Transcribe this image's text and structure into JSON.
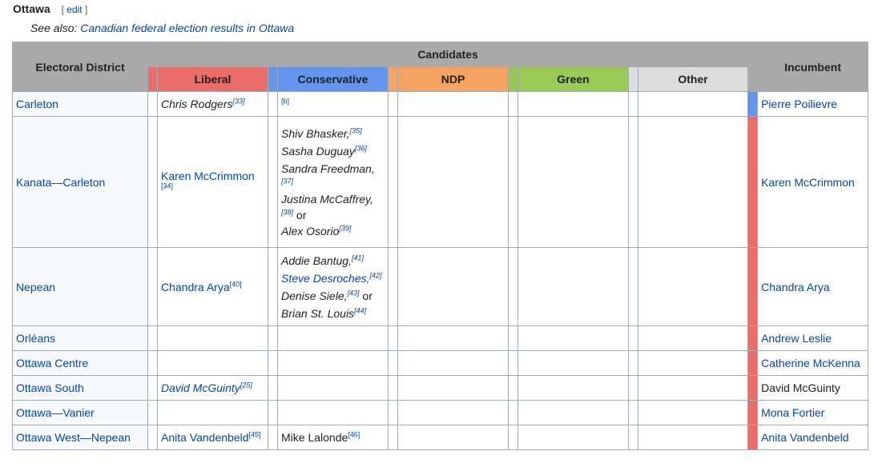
{
  "heading": {
    "title": "Ottawa",
    "edit_open": "[",
    "edit_label": "edit",
    "edit_close": "]"
  },
  "see_also": {
    "prefix": "See also:",
    "link": "Canadian federal election results in Ottawa"
  },
  "headers": {
    "district": "Electoral District",
    "candidates": "Candidates",
    "incumbent": "Incumbent",
    "liberal": "Liberal",
    "conservative": "Conservative",
    "ndp": "NDP",
    "green": "Green",
    "other": "Other"
  },
  "colors": {
    "liberal": "#EA6D6A",
    "conservative": "#6495ED",
    "ndp": "#F4A460",
    "green": "#99C955",
    "other": "#DCDCDC",
    "header_gray": "#a9a9a9"
  },
  "rows": [
    {
      "district": "Carleton",
      "liberal": "Chris Rodgers",
      "liberal_ref": "[33]",
      "conservative_ref": "[b]",
      "incumbent": "Pierre Poilievre"
    },
    {
      "district": "Kanata—Carleton",
      "liberal": "Karen McCrimmon",
      "liberal_ref": "[34]",
      "cons": [
        {
          "name": "Shiv Bhasker,",
          "ref": "[35]"
        },
        {
          "name": "Sasha Duguay",
          "ref": "[36]"
        },
        {
          "name": "Sandra Freedman,",
          "ref": ""
        },
        {
          "name": "",
          "ref": "[37]"
        },
        {
          "name": "Justina McCaffrey,",
          "ref": ""
        },
        {
          "name": "",
          "ref": "[38]",
          "tail": " or"
        },
        {
          "name": "Alex Osorio",
          "ref": "[39]"
        }
      ],
      "incumbent": "Karen McCrimmon"
    },
    {
      "district": "Nepean",
      "liberal": "Chandra Arya",
      "liberal_ref": "[40]",
      "cons": [
        {
          "name": "Addie Bantug,",
          "ref": "[41]"
        },
        {
          "name": "Steve Desroches,",
          "ref": "[42]"
        },
        {
          "name": "Denise Siele,",
          "ref": "[43]",
          "tail": " or"
        },
        {
          "name": "Brian St. Louis",
          "ref": "[44]"
        }
      ],
      "incumbent": "Chandra Arya"
    },
    {
      "district": "Orléans",
      "incumbent": "Andrew Leslie"
    },
    {
      "district": "Ottawa Centre",
      "incumbent": "Catherine McKenna"
    },
    {
      "district": "Ottawa South",
      "liberal": "David McGuinty",
      "liberal_ref": "[25]",
      "incumbent": "David McGuinty"
    },
    {
      "district": "Ottawa—Vanier",
      "incumbent": "Mona Fortier"
    },
    {
      "district": "Ottawa West—Nepean",
      "liberal": "Anita Vandenbeld",
      "liberal_ref": "[45]",
      "conservative": "Mike Lalonde",
      "conservative_ref": "[46]",
      "incumbent": "Anita Vandenbeld"
    }
  ]
}
